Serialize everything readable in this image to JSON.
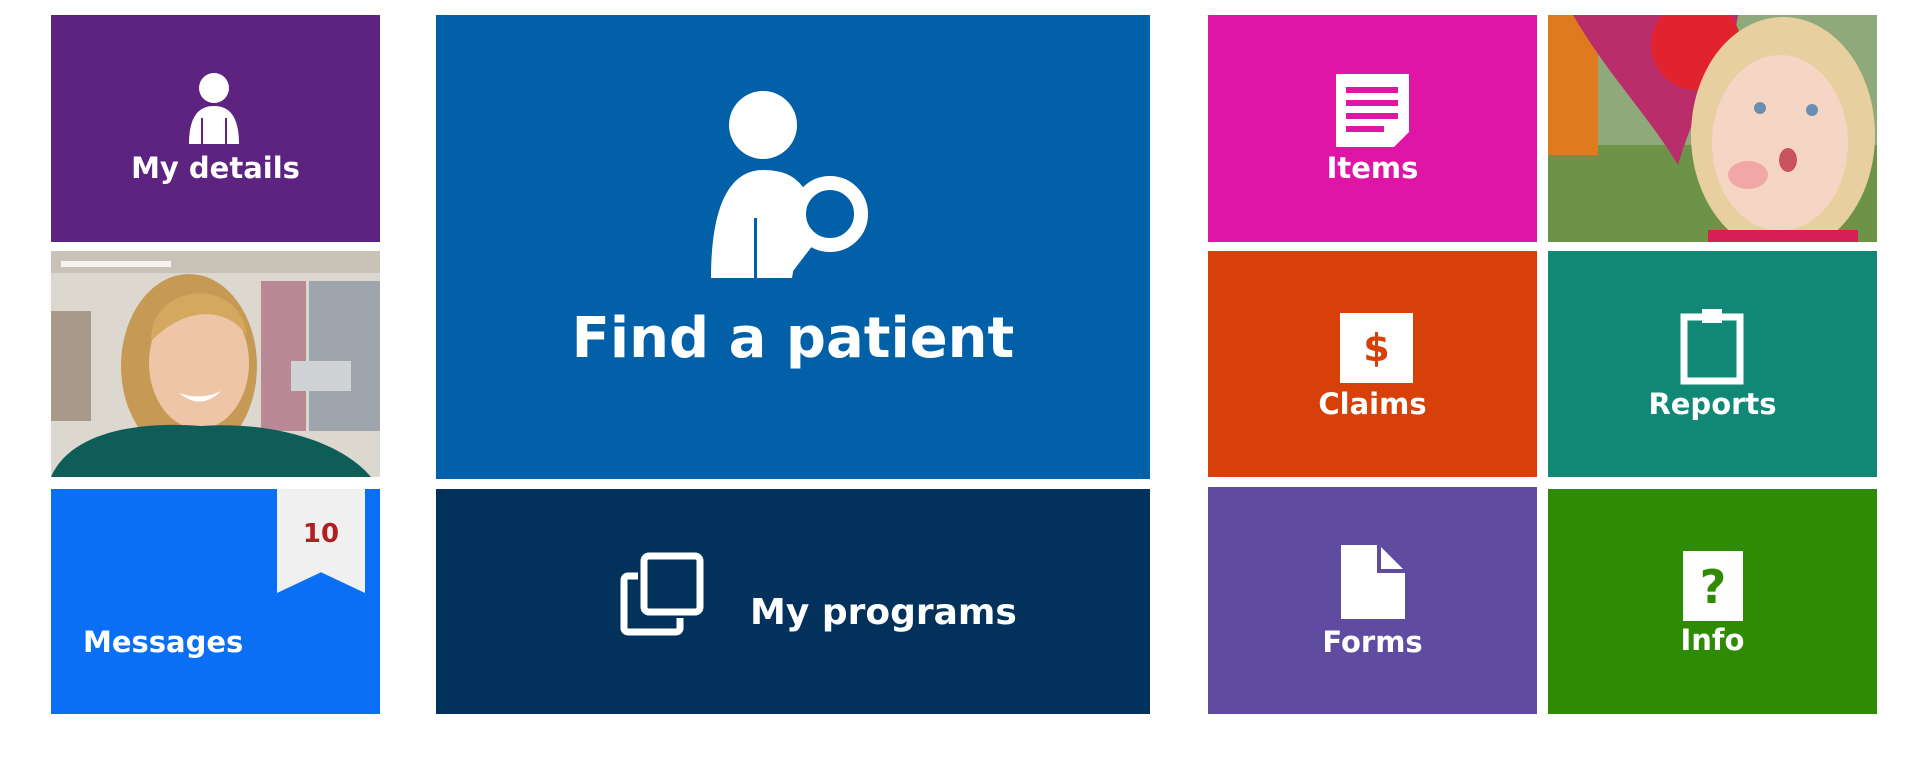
{
  "tiles": {
    "my_details": {
      "label": "My details",
      "icon": "user-icon",
      "color": "#5c2380"
    },
    "find_patient": {
      "label": "Find a patient",
      "icon": "user-search-icon",
      "color": "#0260a8"
    },
    "messages": {
      "label": "Messages",
      "badge_count": "10",
      "color": "#0a6ff5"
    },
    "my_programs": {
      "label": "My programs",
      "icon": "copy-icon",
      "color": "#02325c"
    },
    "items": {
      "label": "Items",
      "icon": "document-lines-icon",
      "color": "#df16a5"
    },
    "claims": {
      "label": "Claims",
      "icon": "dollar-icon",
      "color": "#d74009"
    },
    "reports": {
      "label": "Reports",
      "icon": "clipboard-icon",
      "color": "#108875"
    },
    "forms": {
      "label": "Forms",
      "icon": "file-icon",
      "color": "#5f4b9f"
    },
    "info": {
      "label": "Info",
      "icon": "question-icon",
      "color": "#2f8a04"
    }
  }
}
